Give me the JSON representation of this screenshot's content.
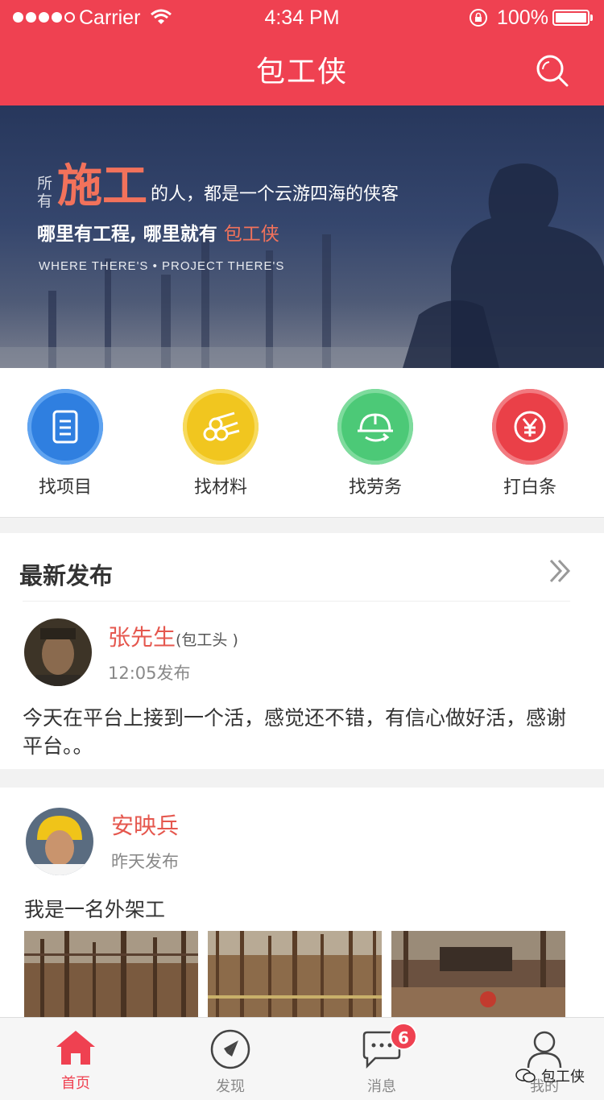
{
  "status_bar": {
    "carrier": "Carrier",
    "time": "4:34 PM",
    "battery": "100%"
  },
  "header": {
    "title": "包工侠",
    "search_icon": "search-icon"
  },
  "banner": {
    "small_top": "所",
    "small_bottom": "有",
    "big": "施工",
    "line1_rest": "的人，都是一个云游四海的侠客",
    "line2_main": "哪里有工程, 哪里就有",
    "line2_highlight": "包工侠",
    "english": "WHERE THERE'S • PROJECT THERE'S"
  },
  "quick_actions": [
    {
      "label": "找项目",
      "icon": "document-icon",
      "color": "#2f7fe0"
    },
    {
      "label": "找材料",
      "icon": "pipes-icon",
      "color": "#f1c61f"
    },
    {
      "label": "找劳务",
      "icon": "helmet-icon",
      "color": "#4cc977"
    },
    {
      "label": "打白条",
      "icon": "yuan-icon",
      "color": "#ea4048"
    }
  ],
  "latest": {
    "title": "最新发布",
    "more_icon": "double-chevron-right-icon",
    "posts": [
      {
        "name": "张先生",
        "role": "(包工头 )",
        "time": "12:05发布",
        "content": "今天在平台上接到一个活，感觉还不错，有信心做好活，感谢平台。。"
      },
      {
        "name": "安映兵",
        "role": "",
        "time": "昨天发布",
        "content": "我是一名外架工"
      }
    ]
  },
  "tabbar": {
    "tabs": [
      {
        "label": "首页",
        "icon": "home-icon"
      },
      {
        "label": "发现",
        "icon": "compass-icon"
      },
      {
        "label": "消息",
        "icon": "chat-icon",
        "badge": "6"
      },
      {
        "label": "我的",
        "icon": "user-icon"
      }
    ]
  },
  "watermark": "包工侠"
}
